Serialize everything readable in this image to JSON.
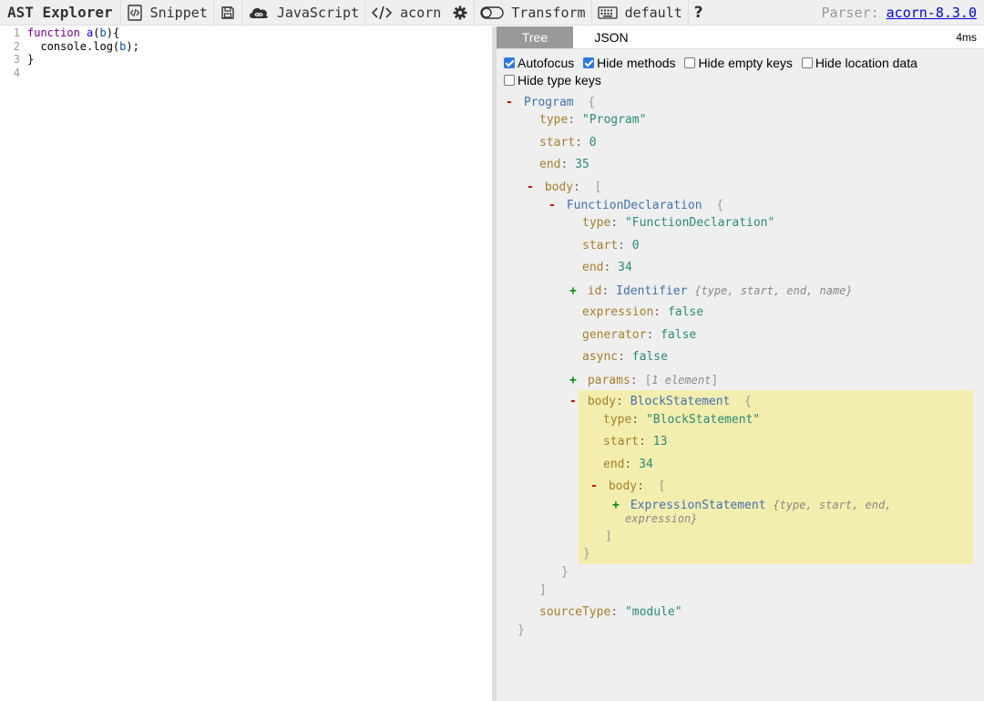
{
  "toolbar": {
    "brand": "AST Explorer",
    "snippet": "Snippet",
    "language": "JavaScript",
    "parser_name": "acorn",
    "transform": "Transform",
    "keymap": "default",
    "help": "?",
    "parser_label": "Parser:",
    "parser_version": "acorn-8.3.0"
  },
  "editor": {
    "lines": [
      {
        "n": "1",
        "kw": "function",
        "fn": " a",
        "p1": "(",
        "arg": "b",
        "p2": "){"
      },
      {
        "n": "2",
        "text": "  console.log(",
        "arg": "b",
        "tail": ");"
      },
      {
        "n": "3",
        "text": "}"
      },
      {
        "n": "4",
        "text": ""
      }
    ]
  },
  "output": {
    "tabs": [
      "Tree",
      "JSON"
    ],
    "timing": "4ms",
    "options": [
      {
        "label": "Autofocus",
        "checked": true
      },
      {
        "label": "Hide methods",
        "checked": true
      },
      {
        "label": "Hide empty keys",
        "checked": false
      },
      {
        "label": "Hide location data",
        "checked": false
      },
      {
        "label": "Hide type keys",
        "checked": false
      }
    ]
  },
  "tree": {
    "program": {
      "type_name": "Program",
      "type_val": "\"Program\"",
      "start": "0",
      "end": "35",
      "sourceType": "\"module\""
    },
    "func": {
      "type_name": "FunctionDeclaration",
      "type_val": "\"FunctionDeclaration\"",
      "start": "0",
      "end": "34",
      "id_type": "Identifier",
      "id_summary": "{type, start, end, name}",
      "expression": "false",
      "generator": "false",
      "async": "false",
      "params_summary": "1 element"
    },
    "block": {
      "type_name": "BlockStatement",
      "type_val": "\"BlockStatement\"",
      "start": "13",
      "end": "34",
      "expr_type": "ExpressionStatement",
      "expr_summary_1": "{type, start, end,",
      "expr_summary_2": "expression}"
    },
    "keys": {
      "type": "type",
      "start": "start",
      "end": "end",
      "body": "body",
      "id": "id",
      "expression": "expression",
      "generator": "generator",
      "async": "async",
      "params": "params",
      "sourceType": "sourceType"
    }
  }
}
